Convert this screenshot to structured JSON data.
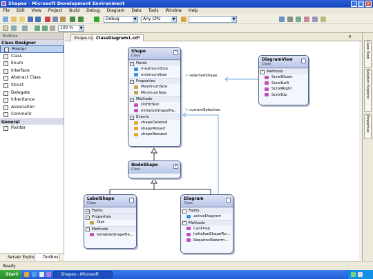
{
  "window": {
    "title": "Shapes - Microsoft Development Environment"
  },
  "menu": [
    "File",
    "Edit",
    "View",
    "Project",
    "Build",
    "Debug",
    "Diagram",
    "Data",
    "Tools",
    "Window",
    "Help"
  ],
  "toolbar": {
    "config": "Debug",
    "platform": "Any CPU",
    "zoom": "100 %"
  },
  "toolbox": {
    "title": "Toolbox",
    "category1": "Class Designer",
    "items": [
      "Pointer",
      "Class",
      "Enum",
      "Interface",
      "Abstract Class",
      "Struct",
      "Delegate",
      "Inheritance",
      "Association",
      "Comment"
    ],
    "category2": "General",
    "general_items": [
      "Pointer"
    ],
    "tabs": [
      "Server Explo...",
      "Toolbox"
    ]
  },
  "doc_tabs": [
    "Shape.cs*",
    "ClassDiagram1.cd*"
  ],
  "right_tabs": [
    "Class View",
    "Solution Explorer",
    "Properties"
  ],
  "status": "Ready",
  "taskbar": {
    "start": "Start",
    "app": "Shapes - Microsoft Dev..."
  },
  "diagram": {
    "shape": {
      "name": "Shape",
      "stereo": "Class",
      "fields_label": "Fields",
      "fields": [
        "maximumSize",
        "minimumSize"
      ],
      "props_label": "Properties",
      "props": [
        "MaximumSize",
        "MinimumSize"
      ],
      "methods_label": "Methods",
      "methods": [
        "DoHitTest",
        "InitializeShapeFie..."
      ],
      "events_label": "Events",
      "events": [
        "shapeDeleted",
        "shapeMoved",
        "shapeResized"
      ]
    },
    "diagramview": {
      "name": "DiagramView",
      "stereo": "Class",
      "methods_label": "Methods",
      "methods": [
        "ScrollDown",
        "ScrollLeft",
        "ScrollRight",
        "ScrollUp"
      ]
    },
    "nodeshape": {
      "name": "NodeShape",
      "stereo": "Class"
    },
    "labelshape": {
      "name": "LabelShape",
      "stereo": "Class",
      "fields_label": "Fields",
      "props_label": "Properties",
      "props": [
        "Text"
      ],
      "methods_label": "Methods",
      "methods": [
        "InitializeShapeFie..."
      ]
    },
    "diagramcls": {
      "name": "Diagram",
      "stereo": "Class",
      "fields_label": "Fields",
      "fields": [
        "activeDiagram"
      ],
      "methods_label": "Methods",
      "methods": [
        "CanDrop",
        "InitializeShapeFie...",
        "RequiresWaterm..."
      ]
    },
    "assoc1": "selectedShape",
    "assoc2": "currentSelection"
  }
}
